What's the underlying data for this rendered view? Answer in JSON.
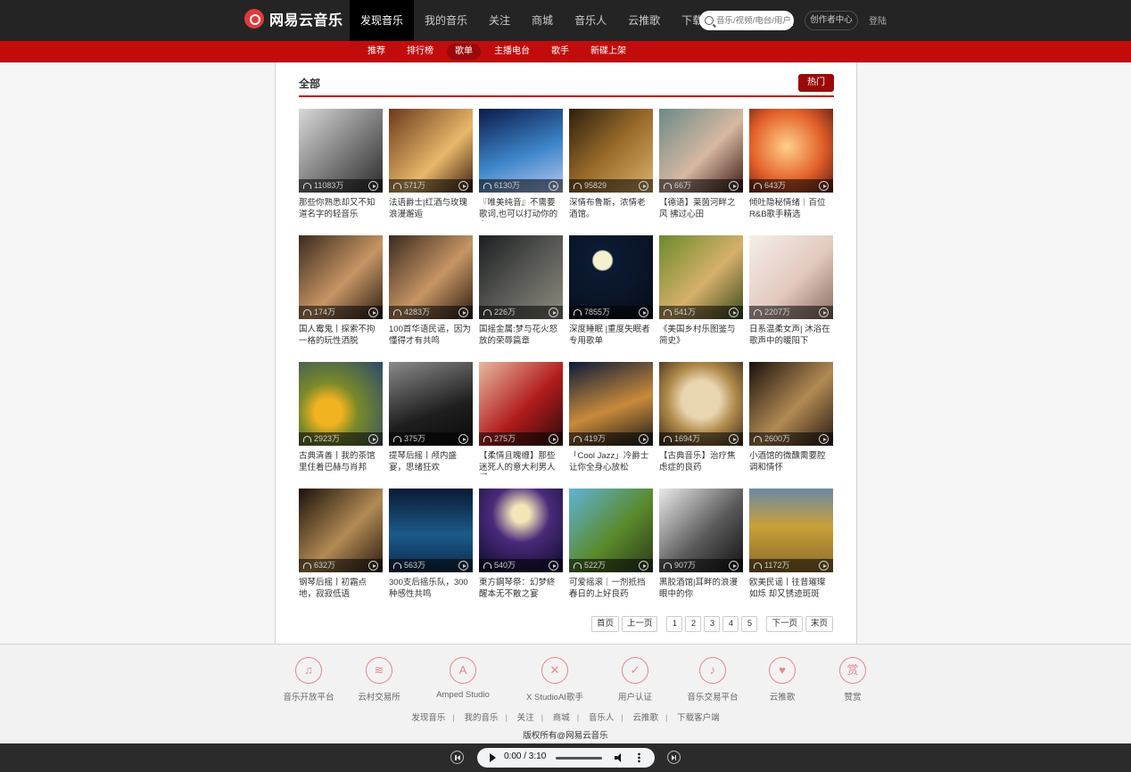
{
  "header": {
    "logo_text": "网易云音乐",
    "nav": [
      "发现音乐",
      "我的音乐",
      "关注",
      "商城",
      "音乐人",
      "云推歌",
      "下载客户端"
    ],
    "search_placeholder": "音乐/视频/电台/用户",
    "creator_label": "创作者中心",
    "login_label": "登陆"
  },
  "subnav": [
    "推荐",
    "排行榜",
    "歌单",
    "主播电台",
    "歌手",
    "新碟上架"
  ],
  "main": {
    "title": "全部",
    "hot_label": "热门",
    "playlists": [
      {
        "title": "那些你熟悉却又不知道名字的轻音乐",
        "count": "11083万"
      },
      {
        "title": "法语爵士|红酒与玫瑰 浪漫邂逅",
        "count": "571万"
      },
      {
        "title": "『唯美纯音』不需要歌词,也可以打动你的心",
        "count": "6130万"
      },
      {
        "title": "深情布鲁斯，浓情老酒馆。",
        "count": "95829"
      },
      {
        "title": "【德语】莱茵河畔之风 拂过心田",
        "count": "66万"
      },
      {
        "title": "倾吐隐秘情绪｜百位R&B歌手精选",
        "count": "643万"
      },
      {
        "title": "国人霉鬼丨探索不拘一格的玩性洒脱",
        "count": "174万"
      },
      {
        "title": "100首华语民谣，因为懂得才有共鸣",
        "count": "4283万"
      },
      {
        "title": "国摇金属:梦与花火怒放的荣辱篇章",
        "count": "226万"
      },
      {
        "title": "深度睡眠 |重度失眠者专用歌单",
        "count": "7855万"
      },
      {
        "title": "《美国乡村乐图鉴与简史》",
        "count": "541万"
      },
      {
        "title": "日系温柔女声| 沐浴在歌声中的暖阳下",
        "count": "2207万"
      },
      {
        "title": "古典清善丨我的茶馆里住着巴赫与肖邦",
        "count": "2923万"
      },
      {
        "title": "提琴后摇丨颅内盛宴，思绪狂欢",
        "count": "375万"
      },
      {
        "title": "【柔情且魄缠】那些迷死人的意大利男人们",
        "count": "275万"
      },
      {
        "title": "「Cool Jazz」冷爵士 让你全身心放松",
        "count": "419万"
      },
      {
        "title": "【古典音乐】治疗焦虑症的良药",
        "count": "1694万"
      },
      {
        "title": "小酒馆的微醺需要腔调和情怀",
        "count": "2600万"
      },
      {
        "title": "钢琴后摇丨初霜点地，寂寂低语",
        "count": "632万"
      },
      {
        "title": "300支后摇乐队，300种感性共鸣",
        "count": "563万"
      },
      {
        "title": "東方鋼琴祭：幻梦終醒本无不散之宴",
        "count": "540万"
      },
      {
        "title": "可爱摇滚｜一剂抵挡春日的上好良药",
        "count": "522万"
      },
      {
        "title": "黑胶酒馆|耳畔的浪漫眼中的你",
        "count": "907万"
      },
      {
        "title": "欧美民谣丨往昔璀璨如烁 却又锈迹斑斑",
        "count": "1172万"
      }
    ]
  },
  "pagination": {
    "first": "首页",
    "prev": "上一页",
    "pages": [
      "1",
      "2",
      "3",
      "4",
      "5"
    ],
    "next": "下一页",
    "last": "末页"
  },
  "footer": {
    "icons": [
      {
        "label": "音乐开放平台",
        "icon": "open-platform-icon",
        "glyph": "♫"
      },
      {
        "label": "云村交易所",
        "icon": "exchange-icon",
        "glyph": "≋"
      },
      {
        "label": "Amped Studio",
        "icon": "amped-studio-icon",
        "glyph": "A"
      },
      {
        "label": "X StudioAI歌手",
        "icon": "x-studio-icon",
        "glyph": "✕"
      },
      {
        "label": "用户认证",
        "icon": "verify-shield-icon",
        "glyph": "✓"
      },
      {
        "label": "音乐交易平台",
        "icon": "music-trade-icon",
        "glyph": "♪"
      },
      {
        "label": "云推歌",
        "icon": "cloud-push-icon",
        "glyph": "♥"
      },
      {
        "label": "赞赏",
        "icon": "appreciate-icon",
        "glyph": "赏"
      }
    ],
    "links": [
      "发现音乐",
      "我的音乐",
      "关注",
      "商城",
      "音乐人",
      "云推歌",
      "下载客户端"
    ],
    "copyright": "版权所有@网易云音乐"
  },
  "player": {
    "time": "0:00 / 3:10"
  },
  "colors": {
    "brand_red": "#c20c0c",
    "topbar": "#242424",
    "accent_pink": "#e3888c"
  }
}
